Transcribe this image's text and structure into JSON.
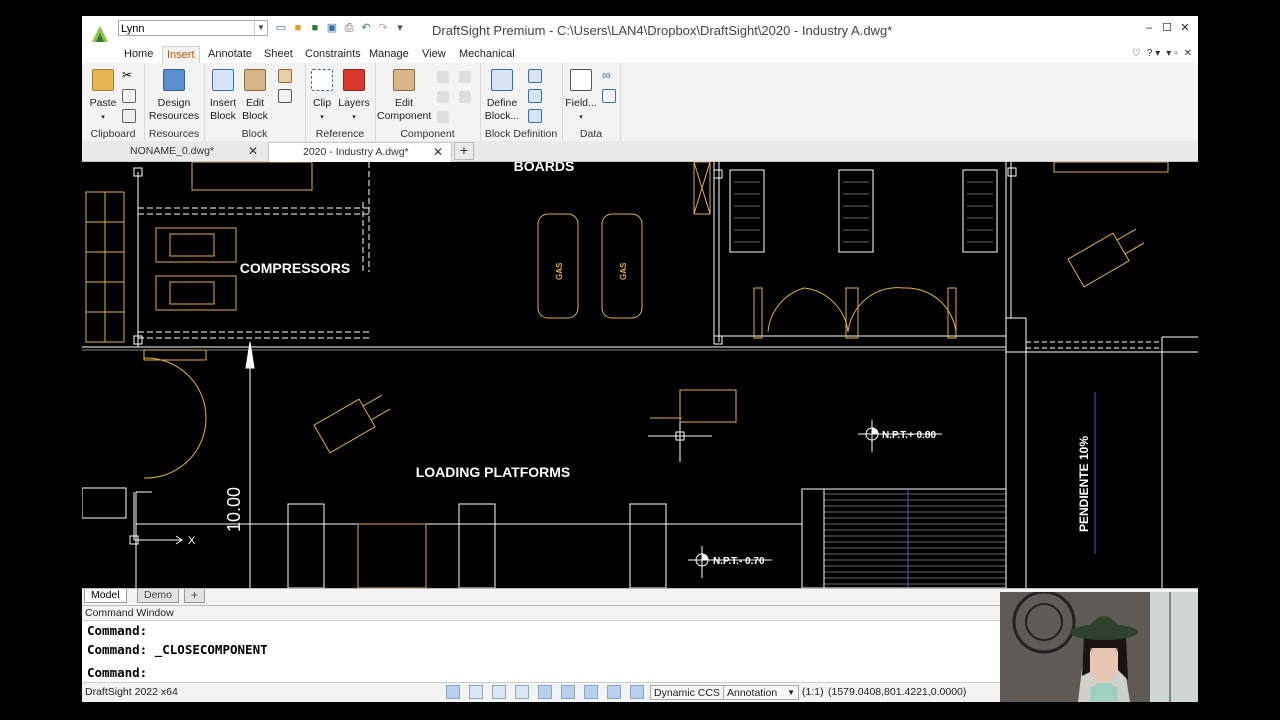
{
  "app": {
    "title": "DraftSight Premium - C:\\Users\\LAN4\\Dropbox\\DraftSight\\2020 - Industry A.dwg*",
    "workspace": "Lynn"
  },
  "menu_tabs": [
    "Home",
    "Insert",
    "Annotate",
    "Sheet",
    "Constraints",
    "Manage",
    "View",
    "Mechanical"
  ],
  "active_tab": "Insert",
  "ribbon": {
    "clipboard": {
      "label": "Clipboard",
      "paste": "Paste"
    },
    "resources": {
      "label": "Resources",
      "design_line1": "Design",
      "design_line2": "Resources"
    },
    "block": {
      "label": "Block",
      "insert_line1": "Insert",
      "insert_line2": "Block",
      "edit_line1": "Edit",
      "edit_line2": "Block"
    },
    "reference": {
      "label": "Reference",
      "clip": "Clip",
      "layers": "Layers"
    },
    "component": {
      "label": "Component",
      "edit_line1": "Edit",
      "edit_line2": "Component"
    },
    "block_definition": {
      "label": "Block Definition",
      "define_line1": "Define",
      "define_line2": "Block..."
    },
    "data": {
      "label": "Data",
      "field": "Field..."
    }
  },
  "doc_tabs": [
    {
      "label": "NONAME_0.dwg*",
      "active": false
    },
    {
      "label": "2020 - Industry A.dwg*",
      "active": true
    }
  ],
  "drawing": {
    "labels": {
      "boards": "BOARDS",
      "compressors": "COMPRESSORS",
      "loading": "LOADING PLATFORMS",
      "npt_pos": "N.P.T.+ 0.80",
      "npt_neg": "N.P.T.- 0.70",
      "pendiente": "PENDIENTE 10%",
      "dim": "10.00",
      "gas": "GAS",
      "axis_x": "X"
    }
  },
  "layout_tabs": [
    "Model",
    "Demo"
  ],
  "active_layout": "Model",
  "command_window": {
    "title": "Command Window",
    "lines": [
      "Command:",
      "Command:  _CLOSECOMPONENT",
      "Command:"
    ]
  },
  "status": {
    "version": "DraftSight 2022 x64",
    "ccs": "Dynamic CCS",
    "annotation": "Annotation",
    "scale": "(1:1)",
    "coords": "(1579.0408,801.4221,0.0000)"
  },
  "colors": {
    "accent": "#c15700",
    "cad_yellow": "#e2b13c",
    "cad_white": "#ffffff"
  }
}
